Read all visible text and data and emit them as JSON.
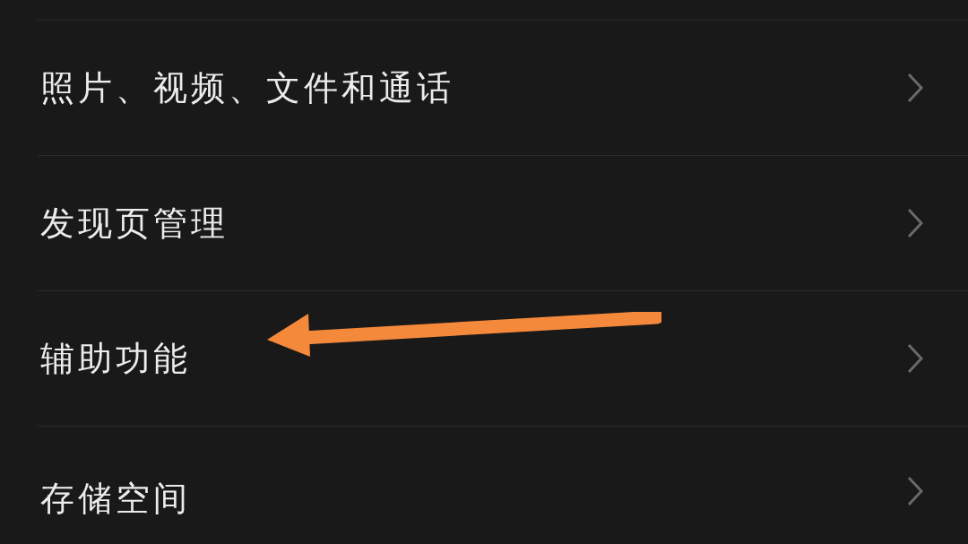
{
  "settings_list": [
    {
      "label": "照片、视频、文件和通话"
    },
    {
      "label": "发现页管理"
    },
    {
      "label": "辅助功能"
    },
    {
      "label": "存储空间"
    }
  ]
}
